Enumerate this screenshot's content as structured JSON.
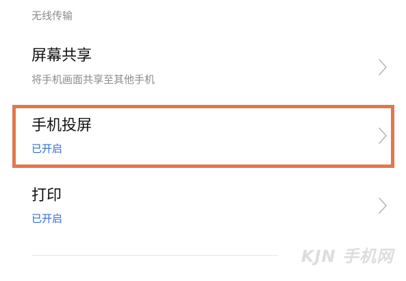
{
  "section": {
    "header": "无线传输"
  },
  "rows": [
    {
      "title": "屏幕共享",
      "subtitle": "将手机画面共享至其他手机"
    },
    {
      "title": "手机投屏",
      "subtitle": "已开启"
    },
    {
      "title": "打印",
      "subtitle": "已开启"
    }
  ],
  "watermark": {
    "text": "KJN 手机网"
  },
  "colors": {
    "highlight_border": "#e2764f",
    "status_blue": "#2f6bd6",
    "secondary_text": "#8a8a8a",
    "chevron": "#b5b5b5"
  },
  "icons": {
    "chevron": "chevron-right-icon"
  }
}
